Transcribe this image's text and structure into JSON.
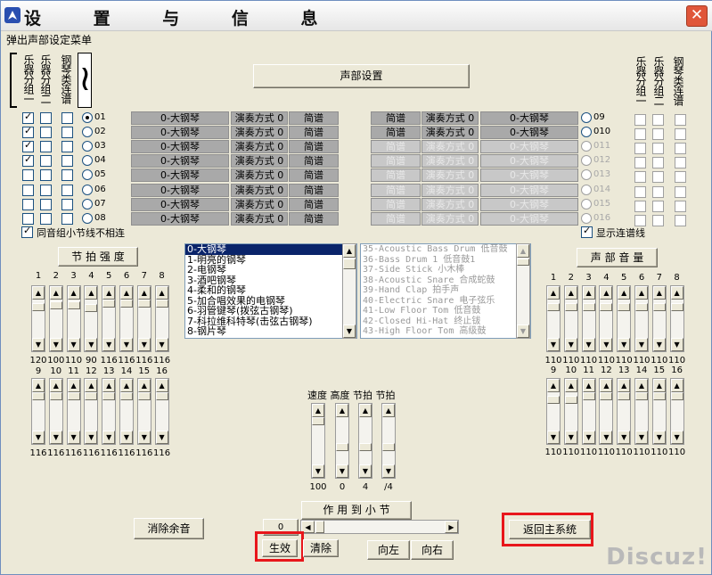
{
  "window": {
    "title": "设 置 与 信 息",
    "close": "✕"
  },
  "menu": {
    "popup_label": "弹出声部设定菜单"
  },
  "left_header": {
    "col1": "乐器分组一",
    "col2": "乐器分组二",
    "col3": "钢琴类连谱",
    "col4_icon": "brace-icon"
  },
  "right_header": {
    "col1": "乐器分组一",
    "col2": "乐器分组二",
    "col3": "钢琴类连谱"
  },
  "voice_setup_button": "声部设置",
  "left_rows": [
    {
      "num": "01",
      "inst": "0-大钢琴",
      "mode_label": "演奏方式",
      "mode_val": "0",
      "notation": "简谱",
      "g1": true,
      "g2": false,
      "p": false,
      "radio": true
    },
    {
      "num": "02",
      "inst": "0-大钢琴",
      "mode_label": "演奏方式",
      "mode_val": "0",
      "notation": "简谱",
      "g1": true,
      "g2": false,
      "p": false,
      "radio": false
    },
    {
      "num": "03",
      "inst": "0-大钢琴",
      "mode_label": "演奏方式",
      "mode_val": "0",
      "notation": "简谱",
      "g1": true,
      "g2": false,
      "p": false,
      "radio": false
    },
    {
      "num": "04",
      "inst": "0-大钢琴",
      "mode_label": "演奏方式",
      "mode_val": "0",
      "notation": "简谱",
      "g1": true,
      "g2": false,
      "p": false,
      "radio": false
    },
    {
      "num": "05",
      "inst": "0-大钢琴",
      "mode_label": "演奏方式",
      "mode_val": "0",
      "notation": "简谱",
      "g1": false,
      "g2": false,
      "p": false,
      "radio": false
    },
    {
      "num": "06",
      "inst": "0-大钢琴",
      "mode_label": "演奏方式",
      "mode_val": "0",
      "notation": "简谱",
      "g1": false,
      "g2": false,
      "p": false,
      "radio": false
    },
    {
      "num": "07",
      "inst": "0-大钢琴",
      "mode_label": "演奏方式",
      "mode_val": "0",
      "notation": "简谱",
      "g1": false,
      "g2": false,
      "p": false,
      "radio": false
    },
    {
      "num": "08",
      "inst": "0-大钢琴",
      "mode_label": "演奏方式",
      "mode_val": "0",
      "notation": "简谱",
      "g1": false,
      "g2": false,
      "p": false,
      "radio": false
    }
  ],
  "right_rows": [
    {
      "num": "09",
      "inst": "0-大钢琴",
      "mode_label": "演奏方式",
      "mode_val": "0",
      "notation": "简谱",
      "enabled": true
    },
    {
      "num": "010",
      "inst": "0-大钢琴",
      "mode_label": "演奏方式",
      "mode_val": "0",
      "notation": "简谱",
      "enabled": true
    },
    {
      "num": "011",
      "inst": "0-大钢琴",
      "mode_label": "演奏方式",
      "mode_val": "0",
      "notation": "简谱",
      "enabled": false
    },
    {
      "num": "012",
      "inst": "0-大钢琴",
      "mode_label": "演奏方式",
      "mode_val": "0",
      "notation": "简谱",
      "enabled": false
    },
    {
      "num": "013",
      "inst": "0-大钢琴",
      "mode_label": "演奏方式",
      "mode_val": "0",
      "notation": "简谱",
      "enabled": false
    },
    {
      "num": "014",
      "inst": "0-大钢琴",
      "mode_label": "演奏方式",
      "mode_val": "0",
      "notation": "简谱",
      "enabled": false
    },
    {
      "num": "015",
      "inst": "0-大钢琴",
      "mode_label": "演奏方式",
      "mode_val": "0",
      "notation": "简谱",
      "enabled": false
    },
    {
      "num": "016",
      "inst": "0-大钢琴",
      "mode_label": "演奏方式",
      "mode_val": "0",
      "notation": "简谱",
      "enabled": false
    }
  ],
  "check_bar_unlink": "同音组小节线不相连",
  "check_show_link": "显示连谱线",
  "beat_strength_button": "节 拍 强 度",
  "voice_volume_button": "声 部 音 量",
  "instrument_list": [
    "0-大钢琴",
    "1-明亮的钢琴",
    "2-电钢琴",
    "3-酒吧钢琴",
    "4-柔和的钢琴",
    "5-加合唱效果的电钢琴",
    "6-羽管键琴(拨弦古钢琴)",
    "7-科拉维科特琴(击弦古钢琴)",
    "8-钢片琴"
  ],
  "drum_list": [
    "35-Acoustic Bass Drum  低音鼓",
    "36-Bass Drum 1 低音鼓1",
    "37-Side Stick 小木棒",
    "38-Acoustic Snare 合成蛇鼓",
    "39-Hand Clap 拍手声",
    "40-Electric Snare 电子弦乐",
    "41-Low Floor Tom 低音鼓",
    "42-Closed Hi-Hat 终止钹",
    "43-High Floor Tom 高级鼓"
  ],
  "beat_top": {
    "labels": [
      "1",
      "2",
      "3",
      "4",
      "5",
      "6",
      "7",
      "8"
    ],
    "values": [
      "120",
      "100",
      "110",
      "90",
      "116",
      "116",
      "116",
      "116"
    ]
  },
  "beat_bottom": {
    "labels": [
      "9",
      "10",
      "11",
      "12",
      "13",
      "14",
      "15",
      "16"
    ],
    "values": [
      "116",
      "116",
      "116",
      "116",
      "116",
      "116",
      "116",
      "116"
    ]
  },
  "vol_top": {
    "labels": [
      "1",
      "2",
      "3",
      "4",
      "5",
      "6",
      "7",
      "8"
    ],
    "values": [
      "110",
      "110",
      "110",
      "110",
      "110",
      "110",
      "110",
      "110"
    ]
  },
  "vol_bottom": {
    "labels": [
      "9",
      "10",
      "11",
      "12",
      "13",
      "14",
      "15",
      "16"
    ],
    "values": [
      "110",
      "110",
      "110",
      "110",
      "110",
      "110",
      "110",
      "110"
    ]
  },
  "center_sliders": {
    "labels": [
      "速度",
      "高度",
      "节拍",
      "节拍"
    ],
    "values": [
      "100",
      "0",
      "4",
      "/4"
    ]
  },
  "buttons": {
    "clear_residual": "消除余音",
    "apply_to_bar": "作 用 到 小 节",
    "bar_value": "0",
    "apply": "生效",
    "clear": "清除",
    "left": "向左",
    "right": "向右",
    "return_main": "返回主系统"
  },
  "watermark": "Discuz!",
  "colors": {
    "highlight": "#e8161b",
    "selection": "#0a246a"
  }
}
